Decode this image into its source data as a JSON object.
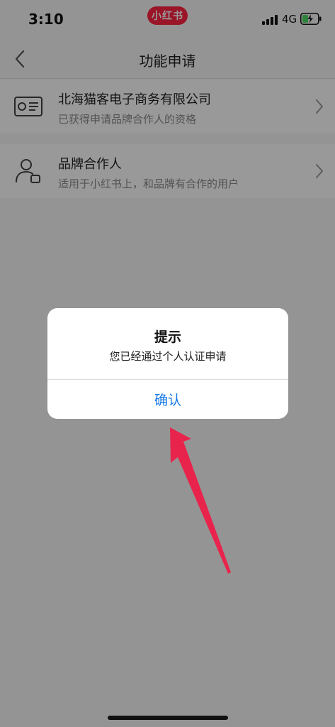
{
  "status_bar": {
    "time": "3:10",
    "app_badge": "小红书",
    "network": "4G"
  },
  "nav": {
    "title": "功能申请"
  },
  "items": [
    {
      "title": "北海猫客电子商务有限公司",
      "subtitle": "已获得申请品牌合作人的资格",
      "icon": "id-card-icon"
    },
    {
      "title": "品牌合作人",
      "subtitle": "适用于小红书上，和品牌有合作的用户",
      "icon": "user-badge-icon"
    }
  ],
  "dialog": {
    "title": "提示",
    "message": "您已经通过个人认证申请",
    "confirm_label": "确认"
  },
  "colors": {
    "brand": "#ff2442",
    "link_blue": "#1677e6",
    "annotation_arrow": "#e8244c",
    "battery_green": "#4cd964"
  }
}
